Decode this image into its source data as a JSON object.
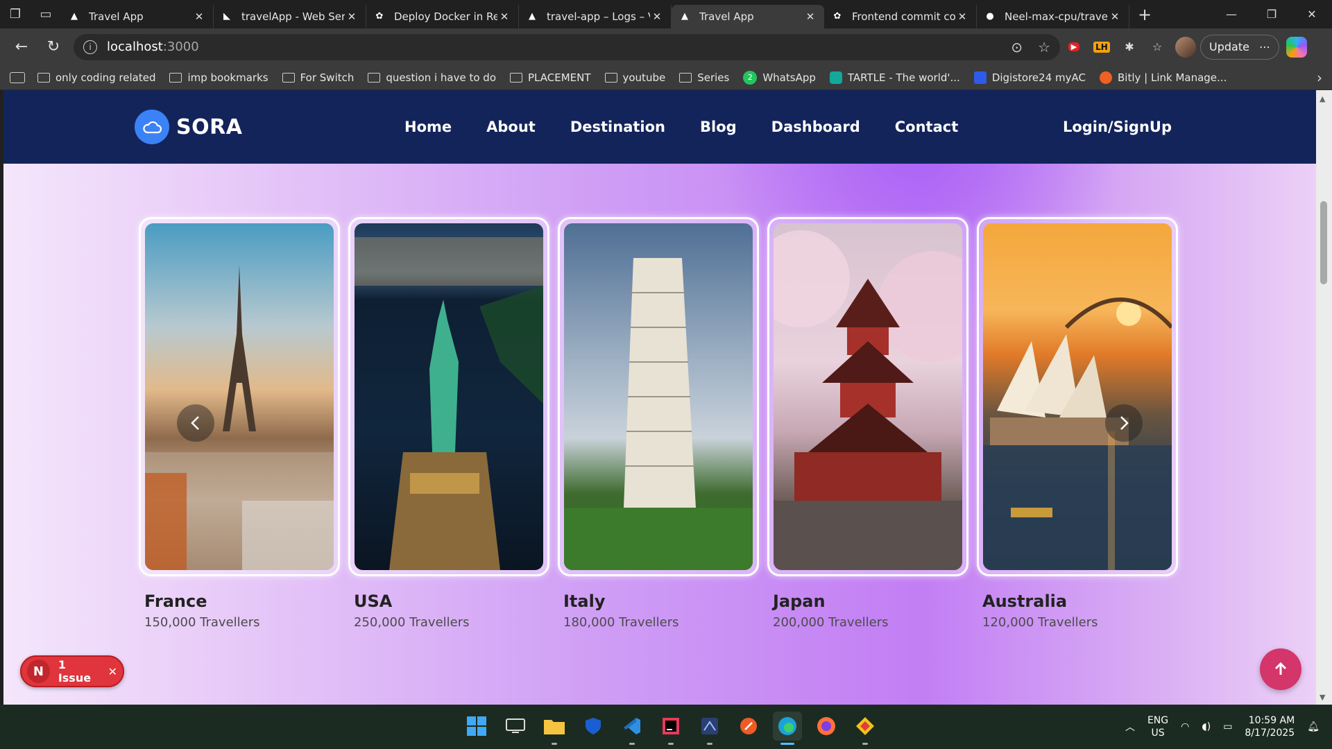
{
  "browser": {
    "tabs": [
      {
        "title": "Travel App",
        "icon": "vercel-icon",
        "active": false
      },
      {
        "title": "travelApp - Web Serv",
        "icon": "render-icon",
        "active": false
      },
      {
        "title": "Deploy Docker in Ren",
        "icon": "openai-icon",
        "active": false
      },
      {
        "title": "travel-app – Logs – Ve",
        "icon": "vercel-icon",
        "active": false
      },
      {
        "title": "Travel App",
        "icon": "vercel-icon",
        "active": true
      },
      {
        "title": "Frontend commit con",
        "icon": "openai-icon",
        "active": false
      },
      {
        "title": "Neel-max-cpu/travelA",
        "icon": "github-icon",
        "active": false
      }
    ],
    "address": {
      "host": "localhost",
      "port": ":3000"
    },
    "update_label": "Update",
    "bookmarks": [
      {
        "label": "only coding  related",
        "icon": "folder-icon"
      },
      {
        "label": "imp bookmarks",
        "icon": "folder-icon"
      },
      {
        "label": "For Switch",
        "icon": "folder-icon"
      },
      {
        "label": "question i have to do",
        "icon": "folder-icon"
      },
      {
        "label": "PLACEMENT",
        "icon": "folder-icon"
      },
      {
        "label": "youtube",
        "icon": "folder-icon"
      },
      {
        "label": "Series",
        "icon": "folder-icon"
      },
      {
        "label": "WhatsApp",
        "icon": "whatsapp-icon"
      },
      {
        "label": "TARTLE - The world'...",
        "icon": "tartle-icon"
      },
      {
        "label": "Digistore24 myAC",
        "icon": "digistore-icon"
      },
      {
        "label": "Bitly | Link Manage...",
        "icon": "bitly-icon"
      }
    ]
  },
  "site": {
    "brand": "SORA",
    "nav": [
      "Home",
      "About",
      "Destination",
      "Blog",
      "Dashboard",
      "Contact"
    ],
    "login_label": "Login/SignUp",
    "destinations": [
      {
        "name": "France",
        "travellers": "150,000 Travellers",
        "scene": "eiffel-tower"
      },
      {
        "name": "USA",
        "travellers": "250,000 Travellers",
        "scene": "statue-of-liberty"
      },
      {
        "name": "Italy",
        "travellers": "180,000 Travellers",
        "scene": "leaning-tower-pisa"
      },
      {
        "name": "Japan",
        "travellers": "200,000 Travellers",
        "scene": "pagoda-cherry-blossom"
      },
      {
        "name": "Australia",
        "travellers": "120,000 Travellers",
        "scene": "sydney-opera-house"
      }
    ],
    "issue_badge": {
      "letter": "N",
      "label": "1 Issue"
    }
  },
  "taskbar": {
    "lang": "ENG",
    "region": "US",
    "time": "10:59 AM",
    "date": "8/17/2025"
  },
  "colors": {
    "navbar": "#13245b",
    "logo_circle": "#3b82f6",
    "issue_badge": "#e0353c",
    "scroll_top": "#d4356a"
  }
}
